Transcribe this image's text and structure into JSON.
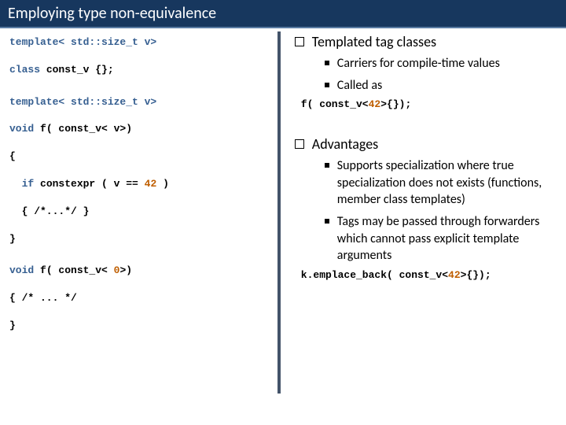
{
  "title": "Employing type non-equivalence",
  "left": {
    "l1": "template< std::size_t v>",
    "l2": "class",
    "l2b": " const_v {};",
    "l3": "template< std::size_t v>",
    "l4": "void",
    "l4b": " f( const_v< v>)",
    "l5": "{",
    "l6a": "  if",
    "l6b": " constexpr ( v == ",
    "l6n": "42",
    "l6c": " )",
    "l7": "  { /*...*/ }",
    "l8": "}",
    "l9": "void",
    "l9b": " f( const_v< ",
    "l9n": "0",
    "l9c": ">)",
    "l10": "{ /* ... */",
    "l11": "}"
  },
  "right": {
    "h1": "Templated tag classes",
    "s1a": "Carriers for compile-time values",
    "s1b": "Called as",
    "c1a": "f( const_v<",
    "c1n": "42",
    "c1b": ">{});",
    "h2": "Advantages",
    "s2a": "Supports specialization where true specialization does not exists (functions, member class templates)",
    "s2b": "Tags may be passed through forwarders which cannot pass explicit template arguments",
    "c2a": "k.emplace_back( const_v<",
    "c2n": "42",
    "c2b": ">{});"
  }
}
